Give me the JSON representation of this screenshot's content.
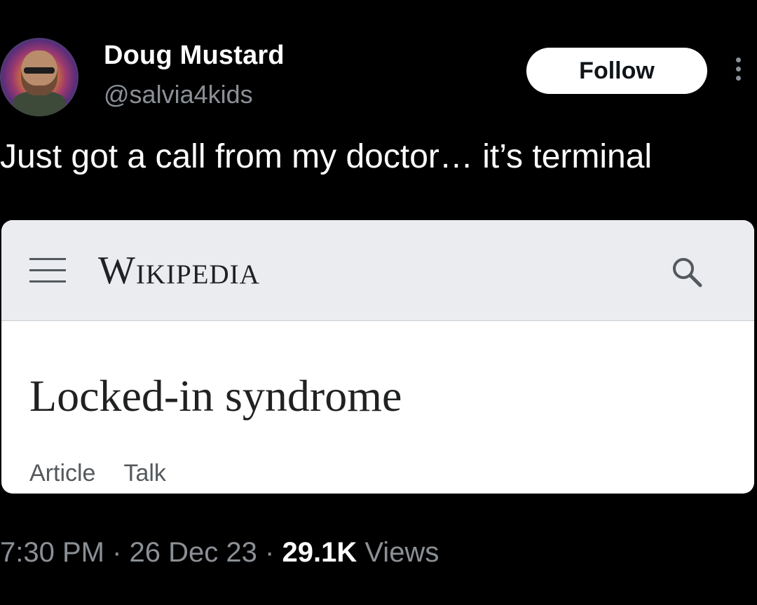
{
  "tweet": {
    "author": {
      "name": "Doug Mustard",
      "handle": "@salvia4kids"
    },
    "follow_label": "Follow",
    "text": "Just got a call from my doctor… it’s terminal",
    "card": {
      "site_logo": "Wikipedia",
      "menu_icon": "hamburger-menu-icon",
      "search_icon": "search-icon",
      "article_title": "Locked-in syndrome",
      "tabs": [
        "Article",
        "Talk"
      ]
    },
    "meta": {
      "time": "7:30 PM",
      "separator": "·",
      "date": "26 Dec 23",
      "views_count": "29.1K",
      "views_label": "Views"
    }
  },
  "colors": {
    "background": "#000000",
    "text_primary": "#ffffff",
    "text_secondary": "#8b9096",
    "card_header": "#eaecf0",
    "card_body": "#ffffff"
  }
}
